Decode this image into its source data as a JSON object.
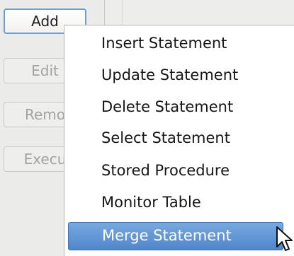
{
  "buttons": {
    "add": "Add",
    "edit": "Edit",
    "remove": "Remo",
    "execute": "Execu"
  },
  "menu": {
    "items": [
      "Insert Statement",
      "Update Statement",
      "Delete Statement",
      "Select Statement",
      "Stored Procedure",
      "Monitor Table",
      "Merge Statement"
    ],
    "highlighted_index": 6
  },
  "colors": {
    "highlight": "#5b8fd3",
    "focus_border": "#6c9ed9",
    "disabled_text": "#a3a3a0"
  },
  "icons": [
    "mouse-pointer-icon"
  ]
}
